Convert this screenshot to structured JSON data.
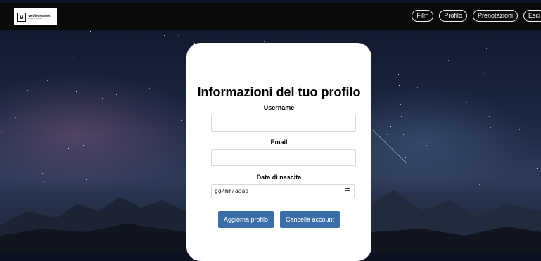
{
  "logo": {
    "title": "VerifiedMovies",
    "subtitle": "cinema planet",
    "mark": "V"
  },
  "nav": [
    {
      "label": "Film"
    },
    {
      "label": "Profilo"
    },
    {
      "label": "Prenotazioni"
    },
    {
      "label": "Esci"
    }
  ],
  "profile": {
    "title": "Informazioni del tuo profilo",
    "username_label": "Username",
    "username_value": "",
    "email_label": "Email",
    "email_value": "",
    "dob_label": "Data di nascita",
    "dob_placeholder": "gg/mm/aaaa",
    "update_button": "Aggiorna profilo",
    "delete_button": "Cancella account"
  },
  "colors": {
    "navbar": "#0a0a0a",
    "button": "#3b6ea8"
  }
}
